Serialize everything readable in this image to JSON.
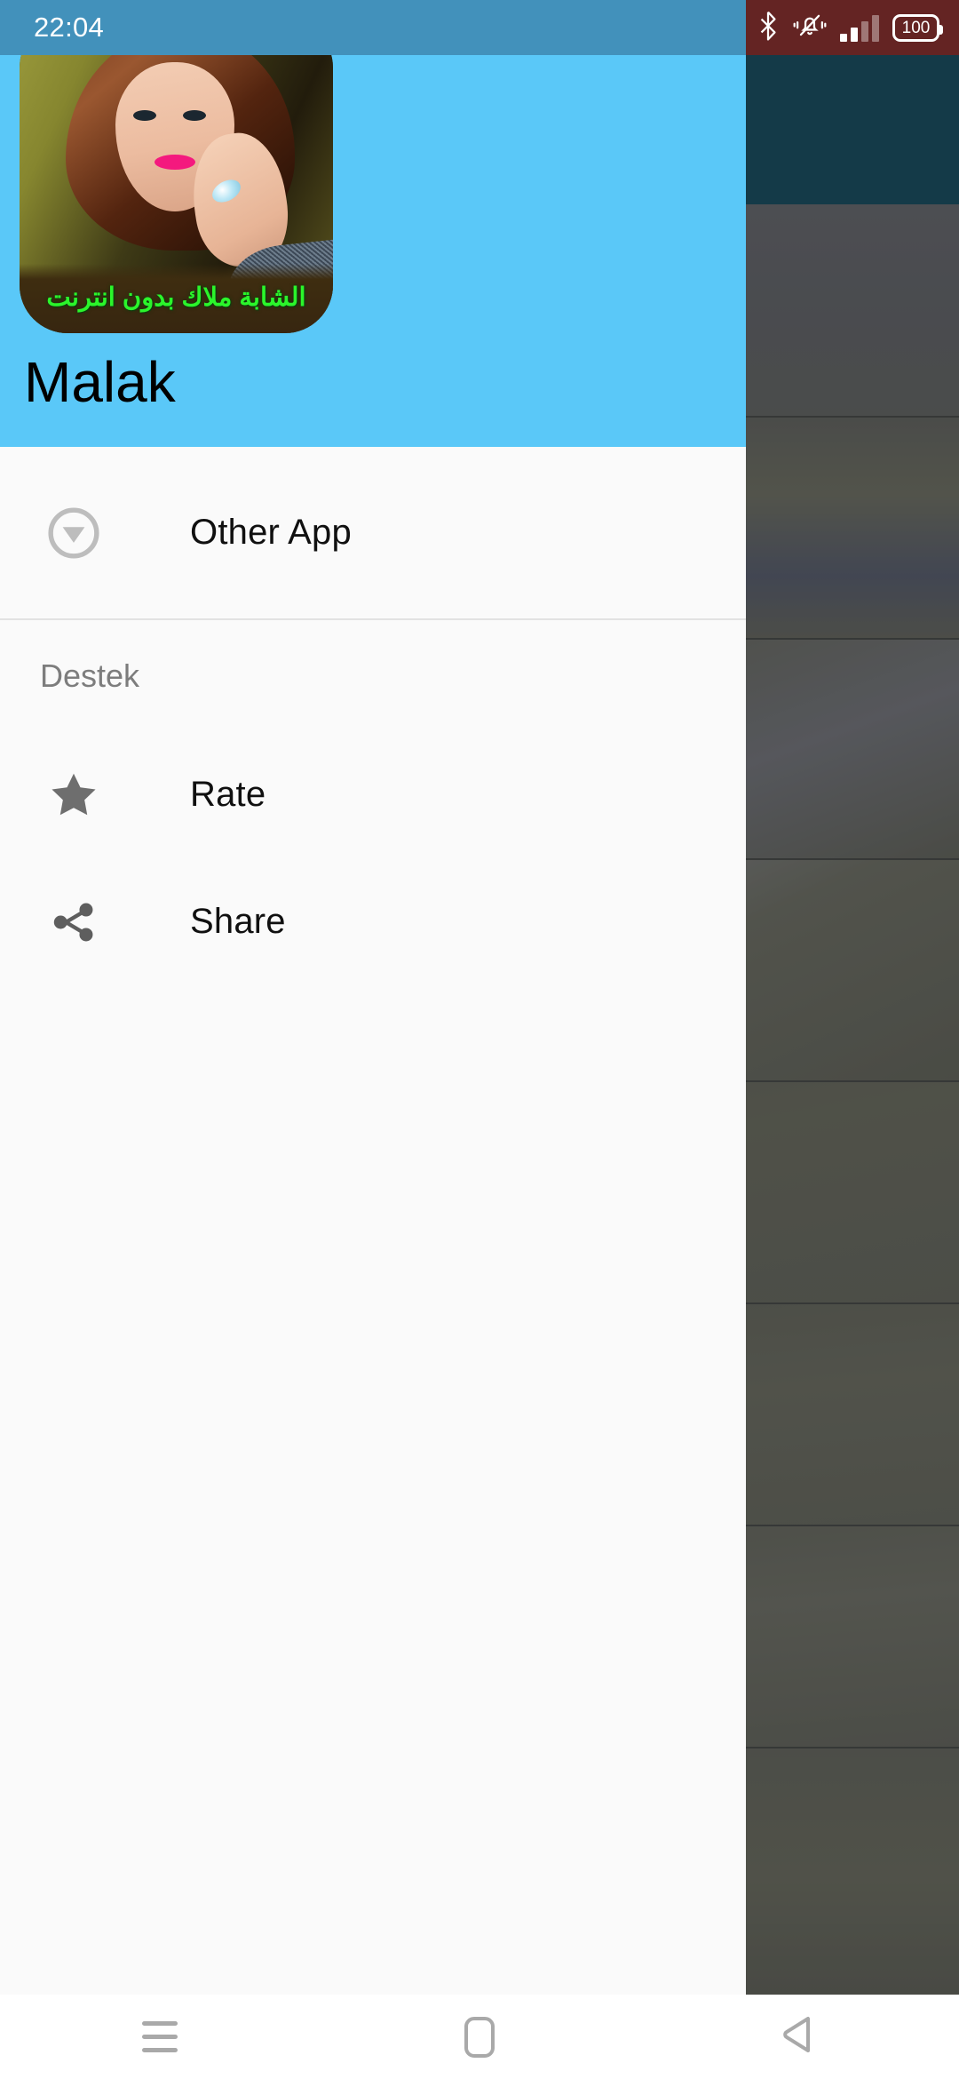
{
  "status_bar": {
    "clock": "22:04",
    "battery_level": "100",
    "icons": [
      "bluetooth-icon",
      "vibrate-mute-icon",
      "signal-icon",
      "battery-icon"
    ],
    "left_zone_color": "#4291bb",
    "right_zone_color": "#642423"
  },
  "drawer": {
    "header": {
      "app_title": "Malak",
      "icon_banner_text": "الشابة ملاك بدون انترنت",
      "background_color": "#5ac8f8",
      "banner_text_color": "#2bf52b"
    },
    "items": [
      {
        "id": "other-app",
        "label": "Other App",
        "icon": "download-circle-icon"
      }
    ],
    "sections": [
      {
        "label": "Destek",
        "items": [
          {
            "id": "rate",
            "label": "Rate",
            "icon": "star-icon"
          },
          {
            "id": "share",
            "label": "Share",
            "icon": "share-icon"
          }
        ]
      }
    ],
    "surface_color": "#fafafa"
  },
  "background_app": {
    "appbar_color": "#1d5468",
    "scrim_color": "rgba(0,0,0,0.30)",
    "list_row_count": 8
  },
  "nav_bar": {
    "buttons": [
      {
        "id": "recents",
        "icon": "recents-menu-icon"
      },
      {
        "id": "home",
        "icon": "home-square-icon"
      },
      {
        "id": "back",
        "icon": "back-triangle-icon"
      }
    ],
    "background_color": "#ffffff",
    "icon_color": "#a9a9a9"
  }
}
